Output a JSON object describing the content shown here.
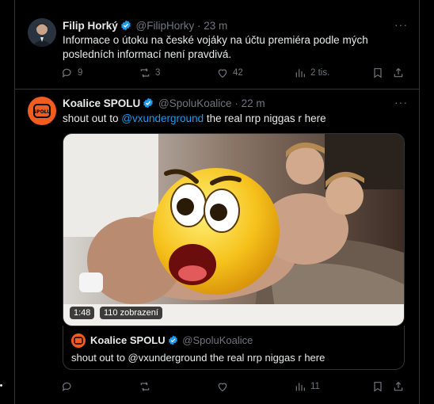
{
  "tweets": [
    {
      "display_name": "Filip Horký",
      "handle": "@FilipHorky",
      "time": "· 23 m",
      "text": "Informace o útoku na české vojáky na účtu premiéra podle mých posledních informací není pravdivá.",
      "replies": "9",
      "retweets": "3",
      "likes": "42",
      "views": "2 tis."
    },
    {
      "display_name": "Koalice SPOLU",
      "handle": "@SpoluKoalice",
      "time": "· 22 m",
      "text_before": "shout out to ",
      "mention": "@vxunderground",
      "text_after": " the real nrp niggas r here",
      "avatar_logo": "SPOLU",
      "video_duration": "1:48",
      "video_views": "110 zobrazení",
      "replies": "",
      "retweets": "",
      "likes": "",
      "views": "11",
      "quote": {
        "display_name": "Koalice SPOLU",
        "handle": "@SpoluKoalice",
        "text": "shout out to @vxunderground the real nrp niggas r here"
      }
    }
  ],
  "colors": {
    "accent": "#1d9bf0",
    "muted": "#71767b",
    "brand_orange": "#f25d1f"
  },
  "icons": [
    "verified-icon",
    "more-icon",
    "reply-icon",
    "retweet-icon",
    "like-icon",
    "views-icon",
    "bookmark-icon",
    "share-icon",
    "shocked-emoji"
  ]
}
